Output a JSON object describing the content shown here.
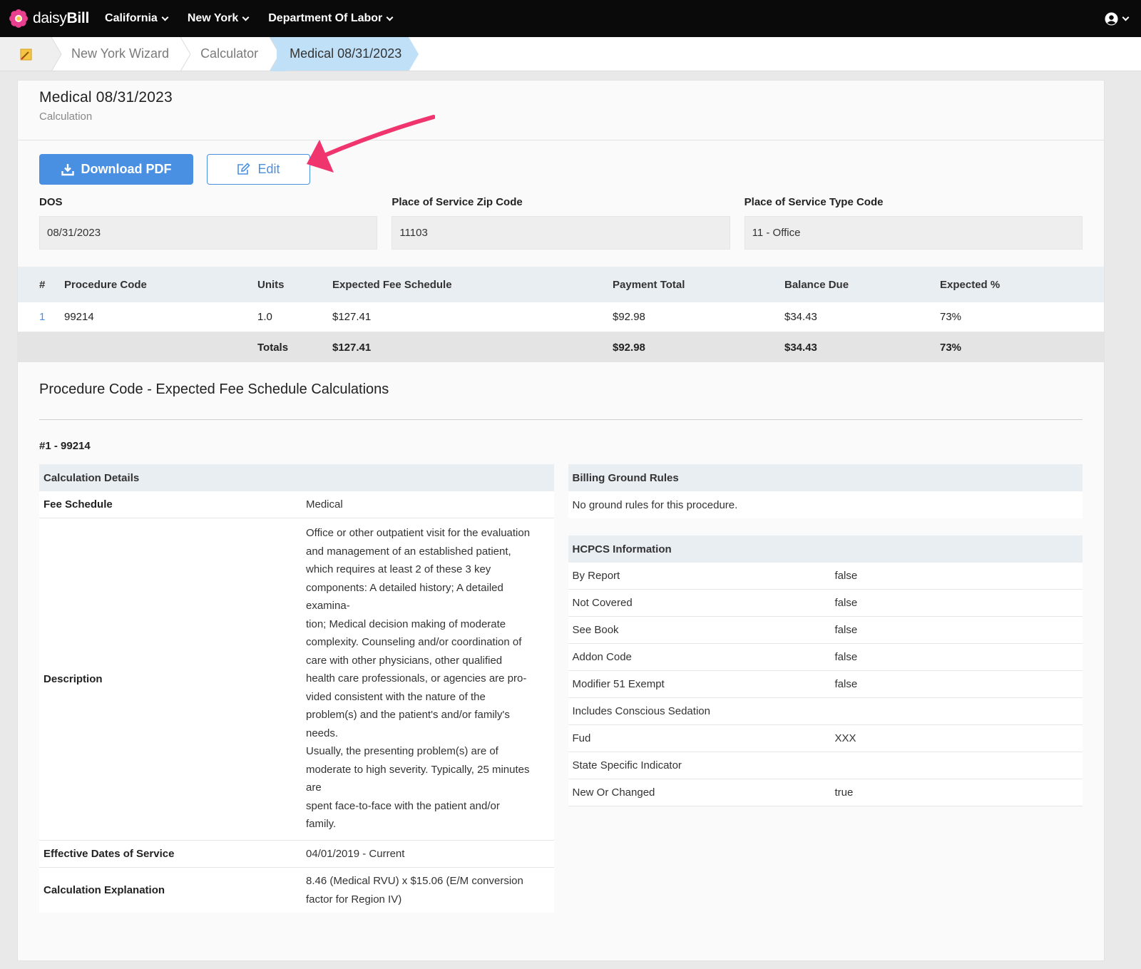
{
  "nav": {
    "brand_light": "daisy",
    "brand_bold": "Bill",
    "items": [
      {
        "label": "California"
      },
      {
        "label": "New York"
      },
      {
        "label": "Department Of Labor"
      }
    ]
  },
  "breadcrumb": {
    "items": [
      {
        "label": "New York Wizard"
      },
      {
        "label": "Calculator"
      }
    ],
    "active": "Medical 08/31/2023"
  },
  "header": {
    "title": "Medical 08/31/2023",
    "subtitle": "Calculation"
  },
  "actions": {
    "download_label": "Download PDF",
    "edit_label": "Edit"
  },
  "fields": {
    "dos": {
      "label": "DOS",
      "value": "08/31/2023"
    },
    "zip": {
      "label": "Place of Service Zip Code",
      "value": "11103"
    },
    "type": {
      "label": "Place of Service Type Code",
      "value": "11 - Office"
    }
  },
  "table": {
    "headers": [
      "#",
      "Procedure Code",
      "Units",
      "Expected Fee Schedule",
      "Payment Total",
      "Balance Due",
      "Expected %"
    ],
    "rows": [
      {
        "num": "1",
        "code": "99214",
        "units": "1.0",
        "fee": "$127.41",
        "payment": "$92.98",
        "balance": "$34.43",
        "pct": "73%"
      }
    ],
    "totals": {
      "label": "Totals",
      "fee": "$127.41",
      "payment": "$92.98",
      "balance": "$34.43",
      "pct": "73%"
    }
  },
  "calc_section": {
    "title": "Procedure Code - Expected Fee Schedule Calculations",
    "proc_label": "#1 - 99214"
  },
  "details": {
    "header": "Calculation Details",
    "fee_schedule_label": "Fee Schedule",
    "fee_schedule_value": "Medical",
    "description_label": "Description",
    "description_lines": [
      "Office or other outpatient visit for the evaluation",
      "and management of an established patient,",
      "which requires at least 2 of these 3 key",
      "components: A detailed history; A detailed",
      "examina-",
      "tion; Medical decision making of moderate",
      "complexity. Counseling and/or coordination of",
      "care with other physicians, other qualified",
      "health care professionals, or agencies are pro-",
      "vided consistent with the nature of the",
      "problem(s) and the patient's and/or family's",
      "needs.",
      "Usually, the presenting problem(s) are of",
      "moderate to high severity. Typically, 25 minutes",
      "are",
      "spent face-to-face with the patient and/or",
      "family."
    ],
    "effective_label": "Effective Dates of Service",
    "effective_value": "04/01/2019 - Current",
    "explanation_label": "Calculation Explanation",
    "explanation_lines": [
      "8.46 (Medical RVU) x $15.06 (E/M conversion",
      "factor for Region IV)"
    ]
  },
  "ground_rules": {
    "header": "Billing Ground Rules",
    "text": "No ground rules for this procedure."
  },
  "hcpcs": {
    "header": "HCPCS Information",
    "rows": [
      {
        "key": "By Report",
        "value": "false"
      },
      {
        "key": "Not Covered",
        "value": "false"
      },
      {
        "key": "See Book",
        "value": "false"
      },
      {
        "key": "Addon Code",
        "value": "false"
      },
      {
        "key": "Modifier 51 Exempt",
        "value": "false"
      },
      {
        "key": "Includes Conscious Sedation",
        "value": ""
      },
      {
        "key": "Fud",
        "value": "XXX"
      },
      {
        "key": "State Specific Indicator",
        "value": ""
      },
      {
        "key": "New Or Changed",
        "value": "true"
      }
    ]
  },
  "colors": {
    "accent": "#4a90e2",
    "annotation_arrow": "#f0346e",
    "breadcrumb_active": "#bfe0f7",
    "nav_bg": "#0a0a0a"
  }
}
